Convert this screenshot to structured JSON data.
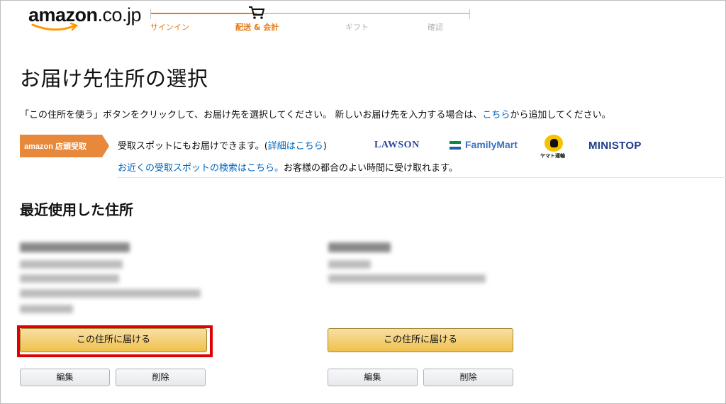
{
  "logo": {
    "text_main": "amazon",
    "text_dot": ".co.jp"
  },
  "progress": {
    "steps": [
      {
        "label": "サインイン",
        "state": "done"
      },
      {
        "label": "配送 & 会計",
        "state": "current"
      },
      {
        "label": "ギフト",
        "state": "upcoming"
      },
      {
        "label": "確認",
        "state": "upcoming"
      }
    ],
    "accent_color": "#e47911"
  },
  "page": {
    "title": "お届け先住所の選択",
    "instructions_before": "「この住所を使う」ボタンをクリックして、お届け先を選択してください。 新しいお届け先を入力する場合は、",
    "instructions_link": "こちら",
    "instructions_after": "から追加してください。"
  },
  "pickup": {
    "badge": "amazon 店頭受取",
    "line1_before": "受取スポットにもお届けできます。(",
    "line1_link": "詳細はこちら",
    "line1_after": ")",
    "line2_link": "お近くの受取スポットの検索はこちら。",
    "line2_after": "お客様の都合のよい時間に受け取れます。",
    "brands": [
      "LAWSON",
      "FamilyMart",
      "ヤマト運輸",
      "MINISTOP"
    ]
  },
  "recent": {
    "heading": "最近使用した住所",
    "addresses": [
      {
        "deliver_label": "この住所に届ける",
        "edit_label": "編集",
        "delete_label": "削除",
        "highlighted": true
      },
      {
        "deliver_label": "この住所に届ける",
        "edit_label": "編集",
        "delete_label": "削除",
        "highlighted": false
      }
    ]
  },
  "colors": {
    "link": "#0066c0",
    "button_primary": "#f0c14b",
    "highlight_border": "#e00000",
    "badge": "#e8883a"
  }
}
